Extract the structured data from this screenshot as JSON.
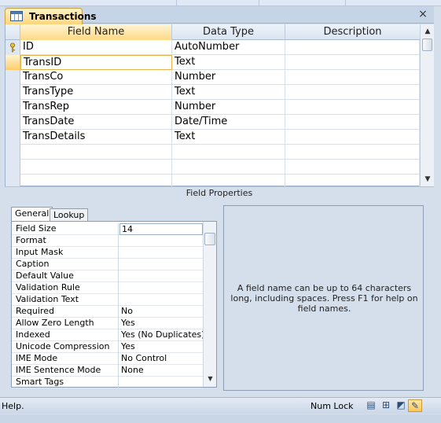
{
  "document": {
    "tab_title": "Transactions",
    "close_symbol": "×"
  },
  "grid": {
    "headers": [
      "Field Name",
      "Data Type",
      "Description"
    ],
    "rows": [
      {
        "name": "ID",
        "type": "AutoNumber",
        "description": "",
        "primary_key": true
      },
      {
        "name": "TransID",
        "type": "Text",
        "description": ""
      },
      {
        "name": "TransCo",
        "type": "Number",
        "description": ""
      },
      {
        "name": "TransType",
        "type": "Text",
        "description": ""
      },
      {
        "name": "TransRep",
        "type": "Number",
        "description": ""
      },
      {
        "name": "TransDate",
        "type": "Date/Time",
        "description": ""
      },
      {
        "name": "TransDetails",
        "type": "Text",
        "description": ""
      },
      {
        "name": "",
        "type": "",
        "description": ""
      },
      {
        "name": "",
        "type": "",
        "description": ""
      },
      {
        "name": "",
        "type": "",
        "description": ""
      }
    ],
    "current_row": 1
  },
  "field_properties": {
    "title": "Field Properties",
    "tabs": [
      "General",
      "Lookup"
    ],
    "active_tab": 0,
    "rows": [
      {
        "name": "Field Size",
        "value": "14"
      },
      {
        "name": "Format",
        "value": ""
      },
      {
        "name": "Input Mask",
        "value": ""
      },
      {
        "name": "Caption",
        "value": ""
      },
      {
        "name": "Default Value",
        "value": ""
      },
      {
        "name": "Validation Rule",
        "value": ""
      },
      {
        "name": "Validation Text",
        "value": ""
      },
      {
        "name": "Required",
        "value": "No"
      },
      {
        "name": "Allow Zero Length",
        "value": "Yes"
      },
      {
        "name": "Indexed",
        "value": "Yes (No Duplicates)"
      },
      {
        "name": "Unicode Compression",
        "value": "Yes"
      },
      {
        "name": "IME Mode",
        "value": "No Control"
      },
      {
        "name": "IME Sentence Mode",
        "value": "None"
      },
      {
        "name": "Smart Tags",
        "value": ""
      }
    ],
    "help_text": "A field name can be up to 64 characters long, including spaces. Press F1 for help on field names."
  },
  "status_bar": {
    "left_text": "Help.",
    "num_lock": "Num Lock",
    "view_buttons": [
      {
        "icon": "datasheet-view-icon",
        "glyph": "▤"
      },
      {
        "icon": "pivottable-view-icon",
        "glyph": "⊞"
      },
      {
        "icon": "pivotchart-view-icon",
        "glyph": "◩"
      },
      {
        "icon": "design-view-icon",
        "glyph": "✎",
        "active": true
      }
    ]
  }
}
